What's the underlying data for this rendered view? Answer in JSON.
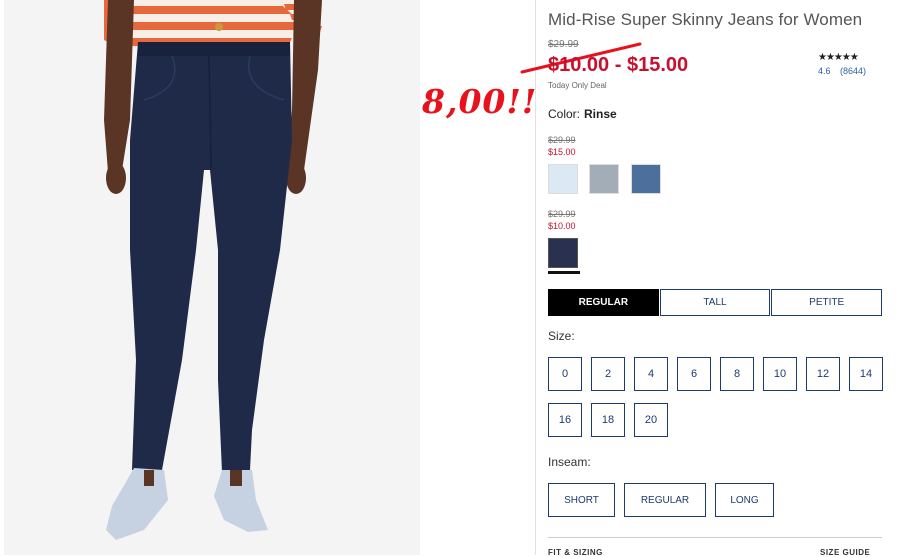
{
  "product": {
    "title": "Mid-Rise Super Skinny Jeans for Women",
    "original_price": "$29.99",
    "sale_price": "$10.00 - $15.00",
    "deal_note": "Today Only Deal"
  },
  "rating": {
    "stars": "★★★★★",
    "score": "4.6",
    "count": "(8644)"
  },
  "annotation": {
    "text": "8,00!!",
    "color": "#e8121d"
  },
  "color": {
    "label": "Color:",
    "selected": "Rinse",
    "groups": [
      {
        "old_price": "$29.99",
        "new_price": "$15.00",
        "swatches": [
          {
            "name": "light-wash",
            "color": "#dce8f3"
          },
          {
            "name": "gray-wash",
            "color": "#a3adb8"
          },
          {
            "name": "medium-wash",
            "color": "#4c6f9c"
          }
        ]
      },
      {
        "old_price": "$29.99",
        "new_price": "$10.00",
        "swatches": [
          {
            "name": "rinse",
            "color": "#2a3150"
          }
        ]
      }
    ]
  },
  "fit_tabs": [
    "REGULAR",
    "TALL",
    "PETITE"
  ],
  "size": {
    "label": "Size:",
    "options": [
      "0",
      "2",
      "4",
      "6",
      "8",
      "10",
      "12",
      "14",
      "16",
      "18",
      "20"
    ]
  },
  "inseam": {
    "label": "Inseam:",
    "options": [
      "SHORT",
      "REGULAR",
      "LONG"
    ]
  },
  "footer_links": {
    "left": "FIT & SIZING",
    "right": "SIZE GUIDE"
  },
  "colors": {
    "accent_red": "#c8102e",
    "navy": "#1e3a6e",
    "link_blue": "#2b5ea7"
  }
}
